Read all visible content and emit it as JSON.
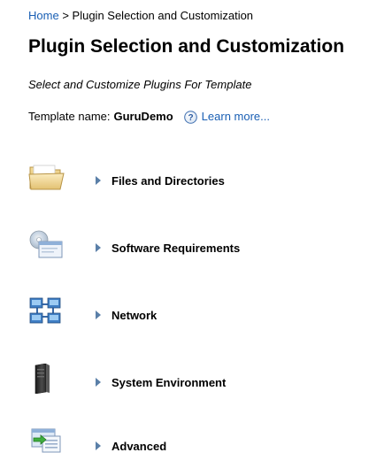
{
  "breadcrumb": {
    "home": "Home",
    "separator": ">",
    "current": "Plugin Selection and Customization"
  },
  "page": {
    "title": "Plugin Selection and Customization",
    "subtitle": "Select and Customize Plugins For Template"
  },
  "template": {
    "label": "Template name:",
    "name": "GuruDemo",
    "help_icon": "help-icon",
    "learn_more": "Learn more..."
  },
  "sections": [
    {
      "label": "Files and Directories",
      "icon": "folder-icon"
    },
    {
      "label": "Software Requirements",
      "icon": "software-cd-icon"
    },
    {
      "label": "Network",
      "icon": "network-icon"
    },
    {
      "label": "System Environment",
      "icon": "server-icon"
    },
    {
      "label": "Advanced",
      "icon": "advanced-icon"
    }
  ],
  "colors": {
    "link": "#1a5fb4",
    "caret": "#5a7fa8"
  }
}
